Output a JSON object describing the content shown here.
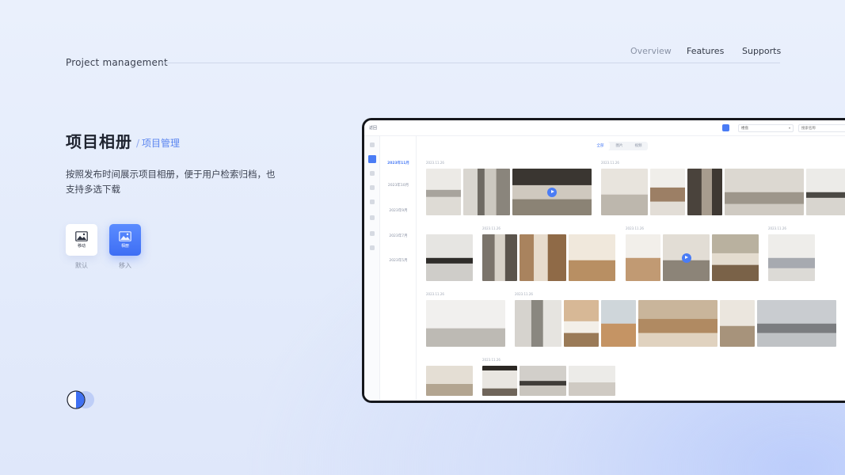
{
  "header": {
    "brand": "Project management",
    "nav": [
      "Overview",
      "Features",
      "Supports"
    ]
  },
  "section": {
    "title": "项目相册",
    "crumb": "项目管理",
    "description": "按照发布时间展示项目相册，便于用户检索归档，也支持多选下载"
  },
  "modes": [
    {
      "card_label": "移动",
      "caption": "默认"
    },
    {
      "card_label": "相册",
      "caption": "移入"
    }
  ],
  "app": {
    "back": "返回",
    "select_value": "楼盘",
    "search_placeholder": "搜索名称",
    "tabs": [
      "全部",
      "图片",
      "视频"
    ],
    "active_tab": "全部",
    "date_filters": [
      "2023年11月",
      "2023年10月",
      "2023年9月",
      "2023年7月",
      "2023年5月"
    ],
    "active_date": "2023年11月",
    "group_dates": [
      "2023.11.26",
      "2023.11.26",
      "2023.11.26",
      "2023.11.26",
      "2023.11.26",
      "2023.11.26",
      "2023.11.26",
      "2023.11.26"
    ]
  },
  "colors": {
    "accent": "#4a7cf5",
    "background": "#e6edfb"
  }
}
